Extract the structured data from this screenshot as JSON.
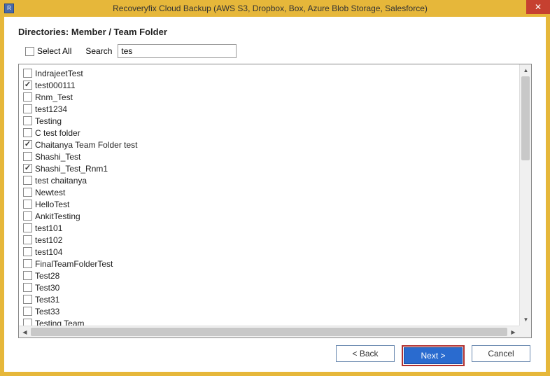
{
  "titlebar": {
    "app_icon_letter": "R",
    "title": "Recoveryfix Cloud Backup (AWS S3, Dropbox, Box, Azure Blob Storage, Salesforce)",
    "close_glyph": "✕"
  },
  "heading": "Directories: Member / Team Folder",
  "select_all": {
    "label": "Select All",
    "checked": false
  },
  "search": {
    "label": "Search",
    "value": "tes"
  },
  "folders": [
    {
      "label": "IndrajeetTest",
      "checked": false
    },
    {
      "label": "test000111",
      "checked": true
    },
    {
      "label": "Rnm_Test",
      "checked": false
    },
    {
      "label": "test1234",
      "checked": false
    },
    {
      "label": "Testing",
      "checked": false
    },
    {
      "label": "C test folder",
      "checked": false
    },
    {
      "label": "Chaitanya Team Folder test",
      "checked": true
    },
    {
      "label": "Shashi_Test",
      "checked": false
    },
    {
      "label": "Shashi_Test_Rnm1",
      "checked": true
    },
    {
      "label": "test chaitanya",
      "checked": false
    },
    {
      "label": "Newtest",
      "checked": false
    },
    {
      "label": "HelloTest",
      "checked": false
    },
    {
      "label": "AnkitTesting",
      "checked": false
    },
    {
      "label": "test101",
      "checked": false
    },
    {
      "label": "test102",
      "checked": false
    },
    {
      "label": "test104",
      "checked": false
    },
    {
      "label": "FinalTeamFolderTest",
      "checked": false
    },
    {
      "label": "Test28",
      "checked": false
    },
    {
      "label": "Test30",
      "checked": false
    },
    {
      "label": "Test31",
      "checked": false
    },
    {
      "label": "Test33",
      "checked": false
    },
    {
      "label": "Testing  Team",
      "checked": false
    }
  ],
  "buttons": {
    "back": "< Back",
    "next": "Next >",
    "cancel": "Cancel"
  },
  "scroll": {
    "up_glyph": "▲",
    "down_glyph": "▼",
    "left_glyph": "◀",
    "right_glyph": "▶"
  }
}
